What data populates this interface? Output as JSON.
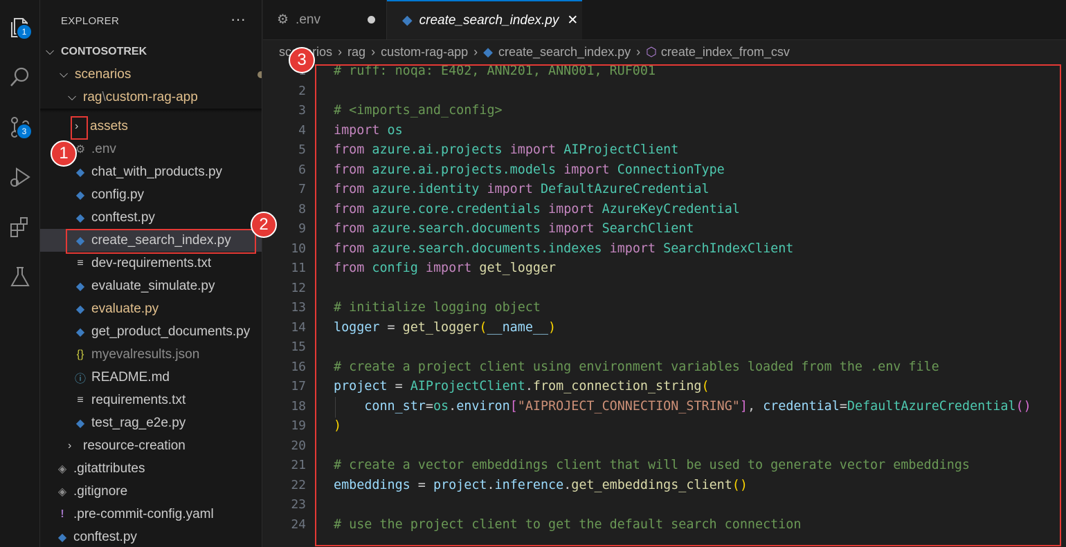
{
  "colors": {
    "keyword": "#c586c0",
    "module": "#4ec9b0",
    "variable": "#9cdcfe",
    "function": "#dcdcaa",
    "string": "#ce9178",
    "comment": "#6a9955",
    "plain": "#cccccc",
    "bracket": "#ffd700",
    "accent": "#0078d4",
    "annotation": "#e53935"
  },
  "activity_bar": {
    "explorer_badge": "1",
    "source_control_badge": "3",
    "icons": [
      "files-icon",
      "search-icon",
      "source-control-icon",
      "run-debug-icon",
      "extensions-icon",
      "testing-icon"
    ]
  },
  "sidebar": {
    "title": "EXPLORER",
    "more": "···",
    "root": "CONTOSOTREK",
    "scenarios": "scenarios",
    "rag_path_a": "rag",
    "rag_path_sep": "\\",
    "rag_path_b": "custom-rag-app",
    "files": [
      {
        "name": "assets"
      },
      {
        "name": ".env"
      },
      {
        "name": "chat_with_products.py"
      },
      {
        "name": "config.py"
      },
      {
        "name": "conftest.py"
      },
      {
        "name": "create_search_index.py"
      },
      {
        "name": "dev-requirements.txt"
      },
      {
        "name": "evaluate_simulate.py"
      },
      {
        "name": "evaluate.py",
        "status": "M"
      },
      {
        "name": "get_product_documents.py"
      },
      {
        "name": "myevalresults.json"
      },
      {
        "name": "README.md"
      },
      {
        "name": "requirements.txt"
      },
      {
        "name": "test_rag_e2e.py"
      }
    ],
    "resource_creation": "resource-creation",
    "root_files": [
      {
        "name": ".gitattributes"
      },
      {
        "name": ".gitignore"
      },
      {
        "name": ".pre-commit-config.yaml"
      },
      {
        "name": "conftest.py"
      }
    ]
  },
  "tabs": [
    {
      "label": ".env"
    },
    {
      "label": "create_search_index.py",
      "close": "✕"
    }
  ],
  "breadcrumb": {
    "items": [
      "scenarios",
      "rag",
      "custom-rag-app",
      "create_search_index.py",
      "create_index_from_csv"
    ],
    "sep": "›"
  },
  "callouts": [
    "1",
    "2",
    "3"
  ],
  "editor": {
    "line_numbers": [
      "1",
      "2",
      "3",
      "4",
      "5",
      "6",
      "7",
      "8",
      "9",
      "10",
      "11",
      "12",
      "13",
      "14",
      "15",
      "16",
      "17",
      "18",
      "19",
      "20",
      "21",
      "22",
      "23",
      "24"
    ],
    "lines": [
      [
        [
          "c",
          "# ruff: noqa: E402, ANN201, ANN001, RUF001"
        ]
      ],
      [],
      [
        [
          "c",
          "# <imports_and_config>"
        ]
      ],
      [
        [
          "k",
          "import"
        ],
        [
          "p",
          " "
        ],
        [
          "m",
          "os"
        ]
      ],
      [
        [
          "k",
          "from"
        ],
        [
          "p",
          " "
        ],
        [
          "m",
          "azure.ai.projects"
        ],
        [
          "p",
          " "
        ],
        [
          "k",
          "import"
        ],
        [
          "p",
          " "
        ],
        [
          "m",
          "AIProjectClient"
        ]
      ],
      [
        [
          "k",
          "from"
        ],
        [
          "p",
          " "
        ],
        [
          "m",
          "azure.ai.projects.models"
        ],
        [
          "p",
          " "
        ],
        [
          "k",
          "import"
        ],
        [
          "p",
          " "
        ],
        [
          "m",
          "ConnectionType"
        ]
      ],
      [
        [
          "k",
          "from"
        ],
        [
          "p",
          " "
        ],
        [
          "m",
          "azure.identity"
        ],
        [
          "p",
          " "
        ],
        [
          "k",
          "import"
        ],
        [
          "p",
          " "
        ],
        [
          "m",
          "DefaultAzureCredential"
        ]
      ],
      [
        [
          "k",
          "from"
        ],
        [
          "p",
          " "
        ],
        [
          "m",
          "azure.core.credentials"
        ],
        [
          "p",
          " "
        ],
        [
          "k",
          "import"
        ],
        [
          "p",
          " "
        ],
        [
          "m",
          "AzureKeyCredential"
        ]
      ],
      [
        [
          "k",
          "from"
        ],
        [
          "p",
          " "
        ],
        [
          "m",
          "azure.search.documents"
        ],
        [
          "p",
          " "
        ],
        [
          "k",
          "import"
        ],
        [
          "p",
          " "
        ],
        [
          "m",
          "SearchClient"
        ]
      ],
      [
        [
          "k",
          "from"
        ],
        [
          "p",
          " "
        ],
        [
          "m",
          "azure.search.documents.indexes"
        ],
        [
          "p",
          " "
        ],
        [
          "k",
          "import"
        ],
        [
          "p",
          " "
        ],
        [
          "m",
          "SearchIndexClient"
        ]
      ],
      [
        [
          "k",
          "from"
        ],
        [
          "p",
          " "
        ],
        [
          "m",
          "config"
        ],
        [
          "p",
          " "
        ],
        [
          "k",
          "import"
        ],
        [
          "p",
          " "
        ],
        [
          "f",
          "get_logger"
        ]
      ],
      [],
      [
        [
          "c",
          "# initialize logging object"
        ]
      ],
      [
        [
          "v",
          "logger"
        ],
        [
          "p",
          " = "
        ],
        [
          "f",
          "get_logger"
        ],
        [
          "b",
          "("
        ],
        [
          "v",
          "__name__"
        ],
        [
          "b",
          ")"
        ]
      ],
      [],
      [
        [
          "c",
          "# create a project client using environment variables loaded from the .env file"
        ]
      ],
      [
        [
          "v",
          "project"
        ],
        [
          "p",
          " = "
        ],
        [
          "m",
          "AIProjectClient"
        ],
        [
          "p",
          "."
        ],
        [
          "f",
          "from_connection_string"
        ],
        [
          "b",
          "("
        ]
      ],
      [
        [
          "p",
          "    "
        ],
        [
          "v",
          "conn_str"
        ],
        [
          "p",
          "="
        ],
        [
          "m",
          "os"
        ],
        [
          "p",
          "."
        ],
        [
          "v",
          "environ"
        ],
        [
          "q",
          "["
        ],
        [
          "s",
          "\"AIPROJECT_CONNECTION_STRING\""
        ],
        [
          "q",
          "]"
        ],
        [
          "p",
          ", "
        ],
        [
          "v",
          "credential"
        ],
        [
          "p",
          "="
        ],
        [
          "m",
          "DefaultAzureCredential"
        ],
        [
          "q",
          "()"
        ]
      ],
      [
        [
          "b",
          ")"
        ]
      ],
      [],
      [
        [
          "c",
          "# create a vector embeddings client that will be used to generate vector embeddings"
        ]
      ],
      [
        [
          "v",
          "embeddings"
        ],
        [
          "p",
          " = "
        ],
        [
          "v",
          "project"
        ],
        [
          "p",
          "."
        ],
        [
          "v",
          "inference"
        ],
        [
          "p",
          "."
        ],
        [
          "f",
          "get_embeddings_client"
        ],
        [
          "b",
          "()"
        ]
      ],
      [],
      [
        [
          "c",
          "# use the project client to get the default search connection"
        ]
      ]
    ]
  }
}
